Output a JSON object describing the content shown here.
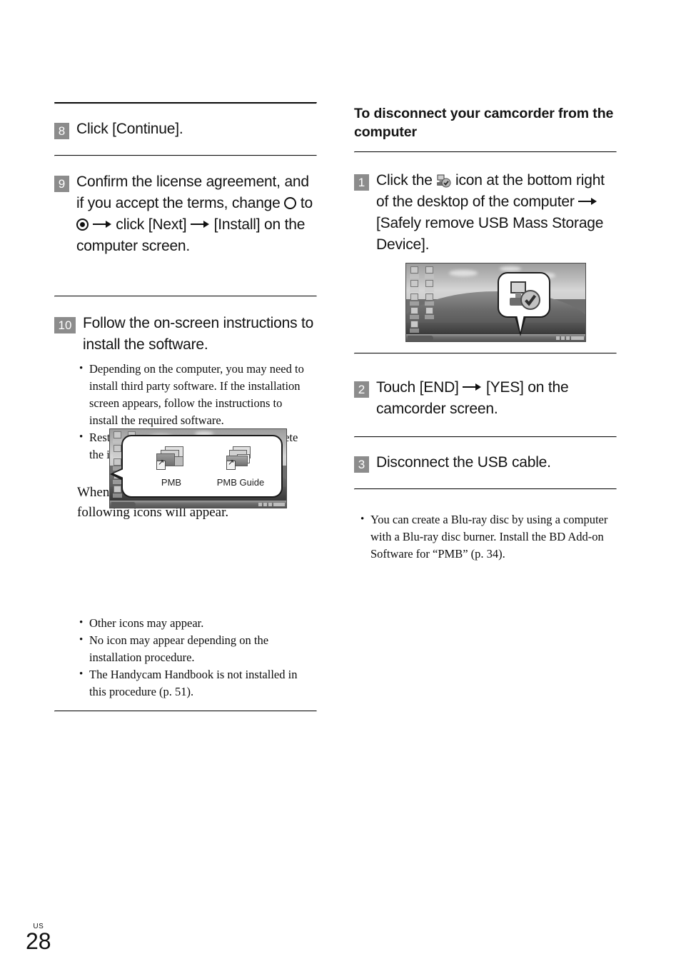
{
  "page": {
    "locale_label": "US",
    "number": "28"
  },
  "left_column": {
    "steps": [
      {
        "number": "8",
        "text": "Click [Continue]."
      },
      {
        "number": "9",
        "text_part1": "Confirm the license agreement, and if you accept the terms, change ",
        "text_part2": " to ",
        "text_part3": " ",
        "text_part4": " click [Next] ",
        "text_part5": " [Install] on the computer screen."
      },
      {
        "number": "10",
        "text": "Follow the on-screen instructions to install the software."
      }
    ],
    "step10_notes": [
      "Depending on the computer, you may need to install third party software. If the installation screen appears, follow the instructions to install the required software.",
      "Restart the computer if required to complete the installation."
    ],
    "step10_paragraph": "When the installation is completed, following icons will appear.",
    "desktop_shot": {
      "icons": [
        {
          "label": "PMB"
        },
        {
          "label": "PMB Guide"
        }
      ]
    },
    "after_notes": [
      "Other icons may appear.",
      "No icon may appear depending on the installation procedure.",
      "The Handycam Handbook is not installed in this procedure (p. 51)."
    ]
  },
  "right_column": {
    "heading": "To disconnect your camcorder from the computer",
    "steps": [
      {
        "number": "1",
        "text_part1": "Click the ",
        "text_part2": " icon at the bottom right of the desktop of the computer ",
        "text_part3": " [Safely remove USB Mass Storage Device]."
      },
      {
        "number": "2",
        "text_part1": "Touch [END] ",
        "text_part2": " [YES] on the camcorder screen."
      },
      {
        "number": "3",
        "text": "Disconnect the USB cable."
      }
    ],
    "final_notes": [
      "You can create a Blu-ray disc by using a computer with a Blu-ray disc burner. Install the BD Add-on Software for “PMB” (p. 34)."
    ]
  },
  "colors": {
    "step_box": "#8c8c8c",
    "rule": "#0a0a0a",
    "text": "#111111"
  }
}
